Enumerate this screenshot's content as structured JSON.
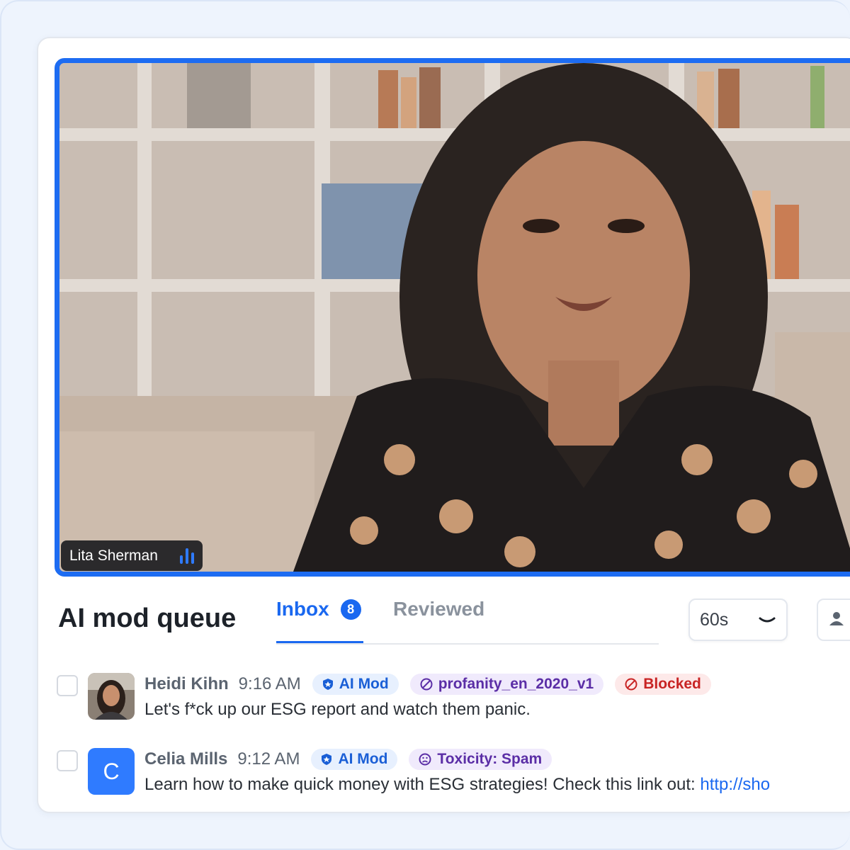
{
  "video": {
    "participant_name": "Lita Sherman",
    "accent_color": "#1d6cf2"
  },
  "queue": {
    "title": "AI mod queue",
    "tabs": [
      {
        "label": "Inbox",
        "count": "8",
        "active": true
      },
      {
        "label": "Reviewed",
        "active": false
      }
    ],
    "interval_select": {
      "value": "60s"
    }
  },
  "messages": [
    {
      "author": "Heidi Kihn",
      "time": "9:16 AM",
      "chips": [
        {
          "label": "AI Mod",
          "icon": "shield-icon"
        },
        {
          "label": "profanity_en_2020_v1",
          "icon": "ban-icon"
        },
        {
          "label": "Blocked",
          "icon": "ban-icon"
        }
      ],
      "text": "Let's f*ck up our ESG report and watch them panic."
    },
    {
      "author": "Celia Mills",
      "avatar_letter": "C",
      "time": "9:12 AM",
      "chips": [
        {
          "label": "AI Mod",
          "icon": "shield-icon"
        },
        {
          "label": "Toxicity: Spam",
          "icon": "frown-icon"
        }
      ],
      "text": "Learn how to make quick money with ESG strategies! Check this link out: ",
      "link": "http://sho"
    }
  ]
}
